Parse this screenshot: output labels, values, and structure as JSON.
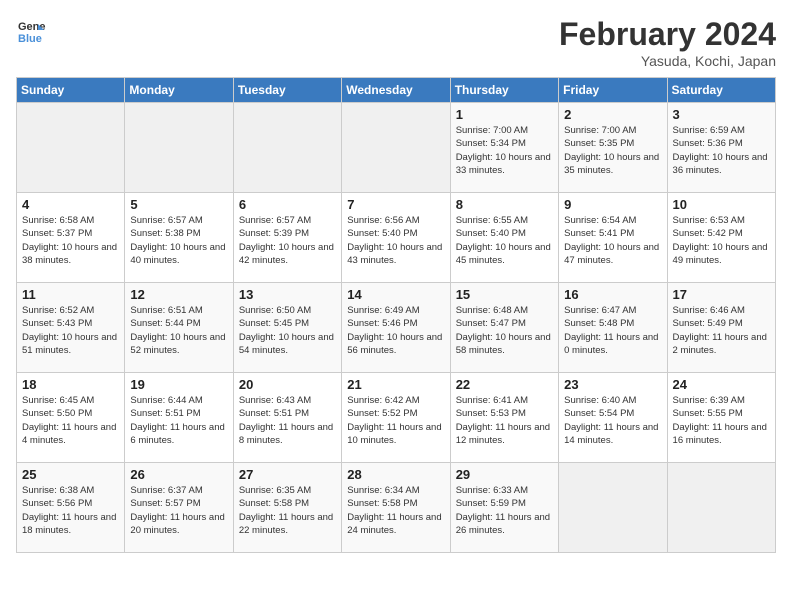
{
  "header": {
    "logo_line1": "General",
    "logo_line2": "Blue",
    "title": "February 2024",
    "subtitle": "Yasuda, Kochi, Japan"
  },
  "weekdays": [
    "Sunday",
    "Monday",
    "Tuesday",
    "Wednesday",
    "Thursday",
    "Friday",
    "Saturday"
  ],
  "weeks": [
    [
      {
        "day": "",
        "info": ""
      },
      {
        "day": "",
        "info": ""
      },
      {
        "day": "",
        "info": ""
      },
      {
        "day": "",
        "info": ""
      },
      {
        "day": "1",
        "info": "Sunrise: 7:00 AM\nSunset: 5:34 PM\nDaylight: 10 hours\nand 33 minutes."
      },
      {
        "day": "2",
        "info": "Sunrise: 7:00 AM\nSunset: 5:35 PM\nDaylight: 10 hours\nand 35 minutes."
      },
      {
        "day": "3",
        "info": "Sunrise: 6:59 AM\nSunset: 5:36 PM\nDaylight: 10 hours\nand 36 minutes."
      }
    ],
    [
      {
        "day": "4",
        "info": "Sunrise: 6:58 AM\nSunset: 5:37 PM\nDaylight: 10 hours\nand 38 minutes."
      },
      {
        "day": "5",
        "info": "Sunrise: 6:57 AM\nSunset: 5:38 PM\nDaylight: 10 hours\nand 40 minutes."
      },
      {
        "day": "6",
        "info": "Sunrise: 6:57 AM\nSunset: 5:39 PM\nDaylight: 10 hours\nand 42 minutes."
      },
      {
        "day": "7",
        "info": "Sunrise: 6:56 AM\nSunset: 5:40 PM\nDaylight: 10 hours\nand 43 minutes."
      },
      {
        "day": "8",
        "info": "Sunrise: 6:55 AM\nSunset: 5:40 PM\nDaylight: 10 hours\nand 45 minutes."
      },
      {
        "day": "9",
        "info": "Sunrise: 6:54 AM\nSunset: 5:41 PM\nDaylight: 10 hours\nand 47 minutes."
      },
      {
        "day": "10",
        "info": "Sunrise: 6:53 AM\nSunset: 5:42 PM\nDaylight: 10 hours\nand 49 minutes."
      }
    ],
    [
      {
        "day": "11",
        "info": "Sunrise: 6:52 AM\nSunset: 5:43 PM\nDaylight: 10 hours\nand 51 minutes."
      },
      {
        "day": "12",
        "info": "Sunrise: 6:51 AM\nSunset: 5:44 PM\nDaylight: 10 hours\nand 52 minutes."
      },
      {
        "day": "13",
        "info": "Sunrise: 6:50 AM\nSunset: 5:45 PM\nDaylight: 10 hours\nand 54 minutes."
      },
      {
        "day": "14",
        "info": "Sunrise: 6:49 AM\nSunset: 5:46 PM\nDaylight: 10 hours\nand 56 minutes."
      },
      {
        "day": "15",
        "info": "Sunrise: 6:48 AM\nSunset: 5:47 PM\nDaylight: 10 hours\nand 58 minutes."
      },
      {
        "day": "16",
        "info": "Sunrise: 6:47 AM\nSunset: 5:48 PM\nDaylight: 11 hours\nand 0 minutes."
      },
      {
        "day": "17",
        "info": "Sunrise: 6:46 AM\nSunset: 5:49 PM\nDaylight: 11 hours\nand 2 minutes."
      }
    ],
    [
      {
        "day": "18",
        "info": "Sunrise: 6:45 AM\nSunset: 5:50 PM\nDaylight: 11 hours\nand 4 minutes."
      },
      {
        "day": "19",
        "info": "Sunrise: 6:44 AM\nSunset: 5:51 PM\nDaylight: 11 hours\nand 6 minutes."
      },
      {
        "day": "20",
        "info": "Sunrise: 6:43 AM\nSunset: 5:51 PM\nDaylight: 11 hours\nand 8 minutes."
      },
      {
        "day": "21",
        "info": "Sunrise: 6:42 AM\nSunset: 5:52 PM\nDaylight: 11 hours\nand 10 minutes."
      },
      {
        "day": "22",
        "info": "Sunrise: 6:41 AM\nSunset: 5:53 PM\nDaylight: 11 hours\nand 12 minutes."
      },
      {
        "day": "23",
        "info": "Sunrise: 6:40 AM\nSunset: 5:54 PM\nDaylight: 11 hours\nand 14 minutes."
      },
      {
        "day": "24",
        "info": "Sunrise: 6:39 AM\nSunset: 5:55 PM\nDaylight: 11 hours\nand 16 minutes."
      }
    ],
    [
      {
        "day": "25",
        "info": "Sunrise: 6:38 AM\nSunset: 5:56 PM\nDaylight: 11 hours\nand 18 minutes."
      },
      {
        "day": "26",
        "info": "Sunrise: 6:37 AM\nSunset: 5:57 PM\nDaylight: 11 hours\nand 20 minutes."
      },
      {
        "day": "27",
        "info": "Sunrise: 6:35 AM\nSunset: 5:58 PM\nDaylight: 11 hours\nand 22 minutes."
      },
      {
        "day": "28",
        "info": "Sunrise: 6:34 AM\nSunset: 5:58 PM\nDaylight: 11 hours\nand 24 minutes."
      },
      {
        "day": "29",
        "info": "Sunrise: 6:33 AM\nSunset: 5:59 PM\nDaylight: 11 hours\nand 26 minutes."
      },
      {
        "day": "",
        "info": ""
      },
      {
        "day": "",
        "info": ""
      }
    ]
  ]
}
